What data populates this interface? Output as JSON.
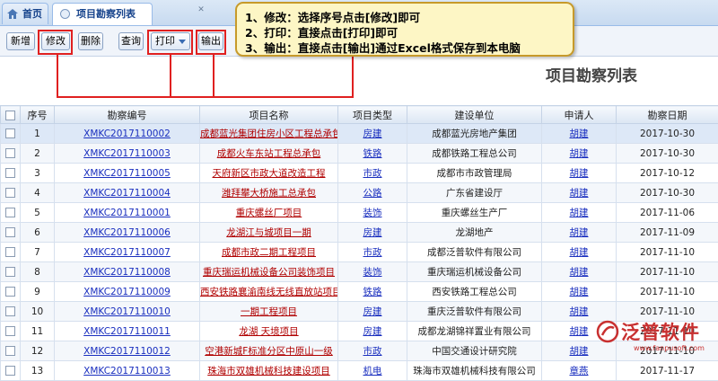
{
  "tabs": [
    {
      "label": "首页"
    },
    {
      "label": "项目勘察列表"
    }
  ],
  "toolbar": {
    "new_label": "新增",
    "edit_label": "修改",
    "delete_label": "删除",
    "query_label": "查询",
    "print_label": "打印",
    "export_label": "输出"
  },
  "callout": {
    "line1": "1、修改：选择序号点击[修改]即可",
    "line2": "2、打印：直接点击[打印]即可",
    "line3": "3、输出：直接点击[输出]通过Excel格式保存到本电脑"
  },
  "page_title": "项目勘察列表",
  "columns": [
    "序号",
    "勘察编号",
    "项目名称",
    "项目类型",
    "建设单位",
    "申请人",
    "勘察日期"
  ],
  "rows": [
    {
      "no": "1",
      "code": "XMKC2017110002",
      "name": "成都蓝光集团住房小区工程总承包",
      "type": "房建",
      "unit": "成都蓝光房地产集团",
      "applicant": "胡建",
      "date": "2017-10-30"
    },
    {
      "no": "2",
      "code": "XMKC2017110003",
      "name": "成都火车东站工程总承包",
      "type": "铁路",
      "unit": "成都铁路工程总公司",
      "applicant": "胡建",
      "date": "2017-10-30"
    },
    {
      "no": "3",
      "code": "XMKC2017110005",
      "name": "天府新区市政大道改造工程",
      "type": "市政",
      "unit": "成都市市政管理局",
      "applicant": "胡建",
      "date": "2017-10-12"
    },
    {
      "no": "4",
      "code": "XMKC2017110004",
      "name": "潍拜攀大桥施工总承包",
      "type": "公路",
      "unit": "广东省建设厅",
      "applicant": "胡建",
      "date": "2017-10-30"
    },
    {
      "no": "5",
      "code": "XMKC2017110001",
      "name": "重庆螺丝厂项目",
      "type": "装饰",
      "unit": "重庆螺丝生产厂",
      "applicant": "胡建",
      "date": "2017-11-06"
    },
    {
      "no": "6",
      "code": "XMKC2017110006",
      "name": "龙湖江与城项目一期",
      "type": "房建",
      "unit": "龙湖地产",
      "applicant": "胡建",
      "date": "2017-11-09"
    },
    {
      "no": "7",
      "code": "XMKC2017110007",
      "name": "成都市政二期工程项目",
      "type": "市政",
      "unit": "成都泛普软件有限公司",
      "applicant": "胡建",
      "date": "2017-11-10"
    },
    {
      "no": "8",
      "code": "XMKC2017110008",
      "name": "重庆瑞运机械设备公司装饰项目",
      "type": "装饰",
      "unit": "重庆瑞运机械设备公司",
      "applicant": "胡建",
      "date": "2017-11-10"
    },
    {
      "no": "9",
      "code": "XMKC2017110009",
      "name": "西安铁路襄渝南线无线直放站项目",
      "type": "铁路",
      "unit": "西安铁路工程总公司",
      "applicant": "胡建",
      "date": "2017-11-10"
    },
    {
      "no": "10",
      "code": "XMKC2017110010",
      "name": "一期工程项目",
      "type": "房建",
      "unit": "重庆泛普软件有限公司",
      "applicant": "胡建",
      "date": "2017-11-10"
    },
    {
      "no": "11",
      "code": "XMKC2017110011",
      "name": "龙湖 天境项目",
      "type": "房建",
      "unit": "成都龙湖锦祥置业有限公司",
      "applicant": "胡建",
      "date": "2017-11-10"
    },
    {
      "no": "12",
      "code": "XMKC2017110012",
      "name": "空港新城F标准分区中原山一级",
      "type": "市政",
      "unit": "中国交通设计研究院",
      "applicant": "胡建",
      "date": "2017-11-10"
    },
    {
      "no": "13",
      "code": "XMKC2017110013",
      "name": "珠海市双雄机械科技建设项目",
      "type": "机电",
      "unit": "珠海市双雄机械科技有限公司",
      "applicant": "章燕",
      "date": "2017-11-17"
    }
  ],
  "watermark": {
    "brand": "泛普软件",
    "url": "www.fanpusoft.com"
  },
  "colors": {
    "highlight_red": "#e02020",
    "link_blue": "#1a2fbf",
    "header_blue": "#15428b",
    "callout_bg": "#fdf6c5"
  }
}
